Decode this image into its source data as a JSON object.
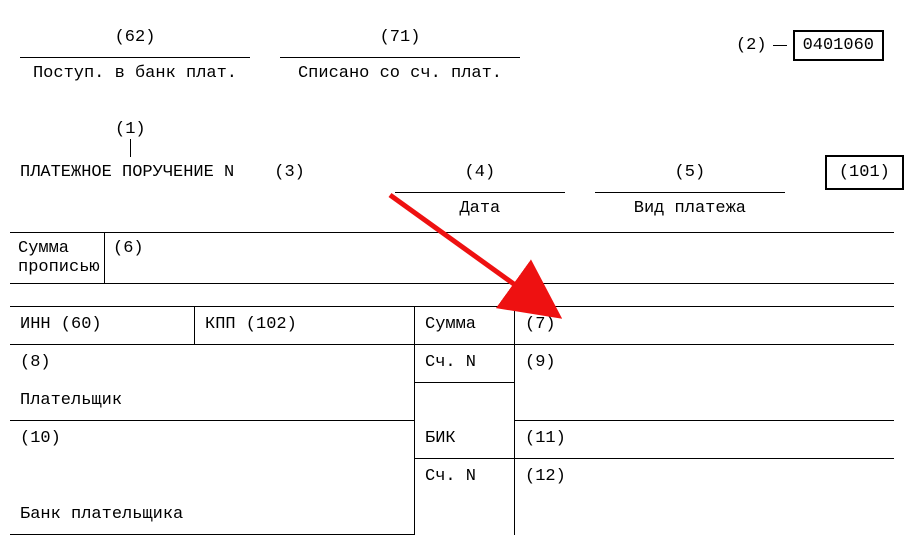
{
  "top": {
    "col1_code": "(62)",
    "col1_label": "Поступ. в банк плат.",
    "col2_code": "(71)",
    "col2_label": "Списано со сч. плат.",
    "right_code": "(2)",
    "form_number": "0401060"
  },
  "title": {
    "above_code": "(1)",
    "text": "ПЛАТЕЖНОЕ ПОРУЧЕНИЕ N",
    "num_code": "(3)",
    "date_code": "(4)",
    "date_label": "Дата",
    "paytype_code": "(5)",
    "paytype_label": "Вид платежа",
    "box101": "(101)"
  },
  "sum": {
    "label": "Сумма прописью",
    "code": "(6)"
  },
  "grid": {
    "inn": "ИНН (60)",
    "kpp": "КПП (102)",
    "sum_label": "Сумма",
    "sum_code": "(7)",
    "row8": "(8)",
    "acct_label": "Сч. N",
    "row9": "(9)",
    "payer_label": "Плательщик",
    "row10": "(10)",
    "bik_label": "БИК",
    "row11": "(11)",
    "row12": "(12)",
    "payer_bank": "Банк плательщика"
  }
}
